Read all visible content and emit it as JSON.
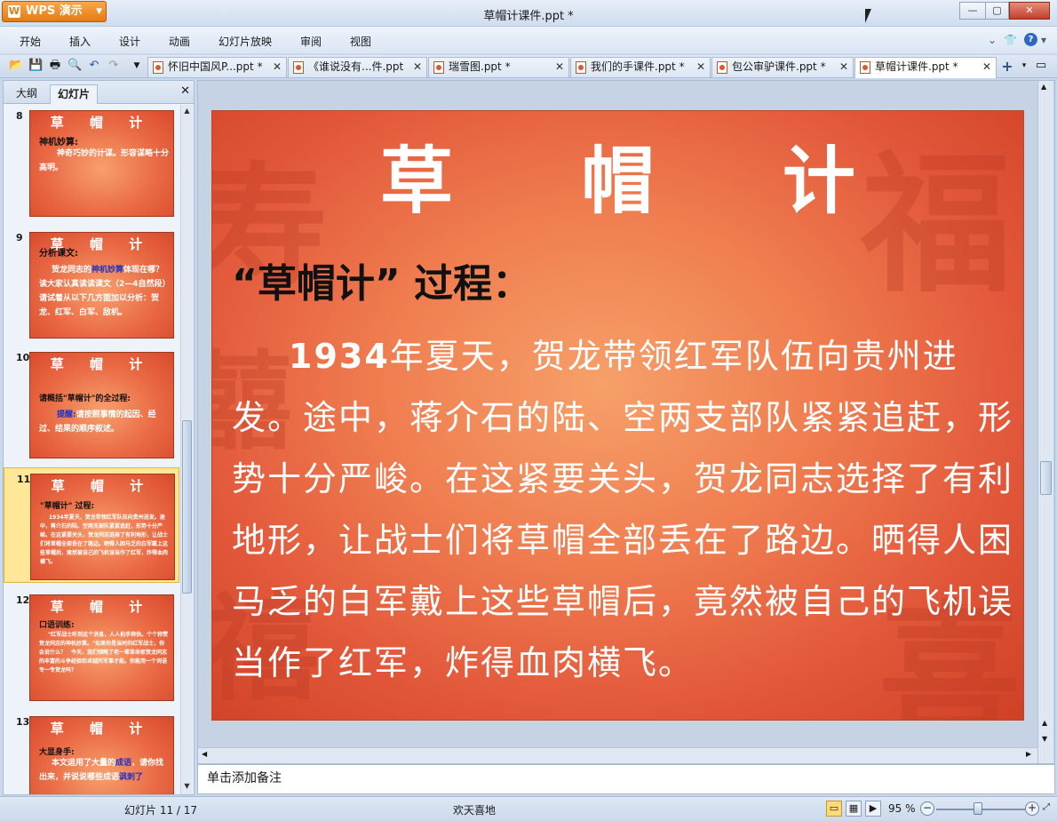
{
  "app": {
    "name": "WPS 演示",
    "window_title": "草帽计课件.ppt *",
    "min": "—",
    "max": "▢",
    "close": "✕"
  },
  "menu": [
    "开始",
    "插入",
    "设计",
    "动画",
    "幻灯片放映",
    "审阅",
    "视图"
  ],
  "tabs": [
    {
      "label": "怀旧中国风P...ppt *",
      "active": false
    },
    {
      "label": "《谁说没有...件.ppt",
      "active": false
    },
    {
      "label": "瑞雪图.ppt *",
      "active": false
    },
    {
      "label": "我们的手课件.ppt *",
      "active": false
    },
    {
      "label": "包公审驴课件.ppt *",
      "active": false
    },
    {
      "label": "草帽计课件.ppt *",
      "active": true
    }
  ],
  "left_panel": {
    "tab_outline": "大纲",
    "tab_slides": "幻灯片",
    "close": "✕"
  },
  "thumbnails": [
    {
      "num": "8",
      "title": "草 帽 计",
      "heading": "神机妙算:",
      "text": "神奇巧妙的计谋。形容谋略十分高明。",
      "selected": false
    },
    {
      "num": "9",
      "title": "草 帽 计",
      "heading": "分析课文:",
      "text_pre": "贺龙同志的",
      "highlight": "神机妙算",
      "text_post": "体现在哪？读大家认真读读课文（2—4自然段）请试着从以下几方面加以分析：贺龙、红军、白军、敌机。",
      "selected": false
    },
    {
      "num": "10",
      "title": "草 帽 计",
      "heading": "请概括\"草帽计\"的全过程:",
      "highlight": "提醒:",
      "text_post": "请按照事情的起因、经过、结果的顺序叙述。",
      "selected": false
    },
    {
      "num": "11",
      "title": "草 帽 计",
      "heading": "\"草帽计\" 过程:",
      "text": "1934年夏天，贺龙带领红军队伍向贵州进发。途中，蒋介石的陆、空两支部队紧紧追赶，形势十分严峻。在这紧要关头，贺龙同志选择了有利地形，让战士们将草帽全部丢在了路边。晒得人困马乏的白军戴上这些草帽后，竟然被自己的飞机误当作了红军，炸得血肉横飞。",
      "selected": true
    },
    {
      "num": "12",
      "title": "草 帽 计",
      "heading": "口语训练:",
      "text": "\"红军战士听到这个消息，人人拍手称快。个个称赞贺龙同志的神机妙算。\"如果你是当时的红军战士，你会说什么？　今天，我们领略了老一辈革命家贺龙同志的丰富的斗争经验和卓越的军事才能。你能用一个词语专一专贺龙吗？",
      "selected": false
    },
    {
      "num": "13",
      "title": "草 帽 计",
      "heading": "大显身手:",
      "text_pre": "本文运用了大量的",
      "highlight": "成语",
      "text_post": "，请你找出来，并说说哪些成语",
      "highlight2": "讽刺了",
      "selected": false
    }
  ],
  "slide": {
    "title": "草 帽 计",
    "heading": "“草帽计” 过程：",
    "year": "1934",
    "body": "年夏天，贺龙带领红军队伍向贵州进发。途中，蒋介石的陆、空两支部队紧紧追赶，形势十分严峻。在这紧要关头，贺龙同志选择了有利地形，让战士们将草帽全部丢在了路边。晒得人困马乏的白军戴上这些草帽后，竟然被自己的飞机误当作了红军，炸得血肉横飞。"
  },
  "notes_placeholder": "单击添加备注",
  "status": {
    "slide_counter": "幻灯片 11 / 17",
    "theme": "欢天喜地",
    "zoom": "95 %"
  }
}
